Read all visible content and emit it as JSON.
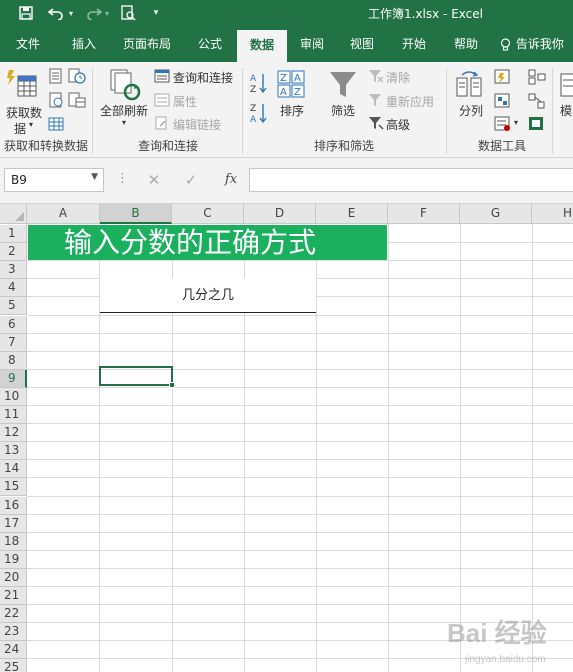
{
  "window": {
    "title": "工作簿1.xlsx  -  Excel"
  },
  "tabs": [
    "文件",
    "插入",
    "页面布局",
    "公式",
    "数据",
    "审阅",
    "视图",
    "开始",
    "帮助"
  ],
  "active_tab": "数据",
  "tell_me": "告诉我你",
  "ribbon": {
    "get_data": "获取数",
    "get_data_2": "据",
    "refresh_all": "全部刷新",
    "queries_connections": "查询和连接",
    "properties": "属性",
    "edit_links": "编辑链接",
    "sort": "排序",
    "filter": "筛选",
    "clear": "清除",
    "reapply": "重新应用",
    "advanced": "高级",
    "text_to_columns": "分列",
    "mo": "模",
    "groups": {
      "get_transform": "获取和转换数据",
      "queries": "查询和连接",
      "sort_filter": "排序和筛选",
      "data_tools": "数据工具"
    }
  },
  "formula_bar": {
    "name_box": "B9",
    "formula": ""
  },
  "columns": [
    "A",
    "B",
    "C",
    "D",
    "E",
    "F",
    "G",
    "H"
  ],
  "rows": [
    "1",
    "2",
    "3",
    "4",
    "5",
    "6",
    "7",
    "8",
    "9",
    "10",
    "11",
    "12",
    "13",
    "14",
    "15",
    "16",
    "17",
    "18",
    "19",
    "20",
    "21",
    "22",
    "23",
    "24",
    "25"
  ],
  "selected_column": "B",
  "selected_row": "9",
  "cells": {
    "banner": "输入分数的正确方式",
    "subtitle": "几分之几"
  },
  "watermark": "Bai 经验",
  "watermark_url": "jingyan.baidu.com",
  "colors": {
    "excel_green": "#217346",
    "banner_green": "#1ab05e"
  }
}
